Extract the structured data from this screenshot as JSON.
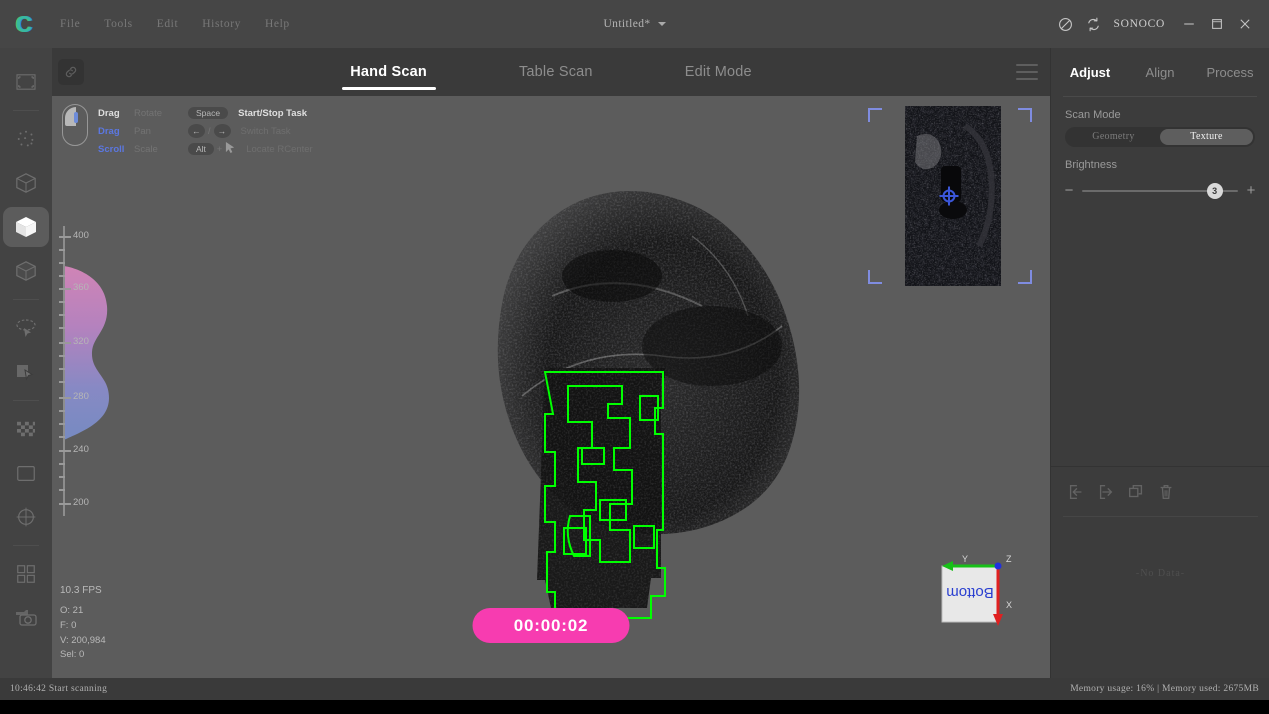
{
  "titlebar": {
    "logo": "crescent-logo",
    "menu": [
      "File",
      "Tools",
      "Edit",
      "History",
      "Help"
    ],
    "document_title": "Untitled*",
    "brand": "SONOCO",
    "icons": [
      "no-entry-icon",
      "sync-icon"
    ],
    "window_buttons": [
      "minimize",
      "maximize",
      "close"
    ]
  },
  "left_toolbar": {
    "items": [
      {
        "name": "crop-frame-icon",
        "selected": false
      },
      {
        "name": "point-cloud-icon",
        "selected": false
      },
      {
        "name": "wireframe-cube-icon",
        "selected": false
      },
      {
        "name": "solid-cube-icon",
        "selected": true
      },
      {
        "name": "shaded-cube-icon",
        "selected": false
      },
      {
        "name": "lasso-select-icon",
        "selected": false
      },
      {
        "name": "plane-select-icon",
        "selected": false
      },
      {
        "name": "checkerboard-icon",
        "selected": false
      },
      {
        "name": "square-icon",
        "selected": false
      },
      {
        "name": "target-circle-icon",
        "selected": false
      },
      {
        "name": "grid-four-icon",
        "selected": false
      },
      {
        "name": "texture-camera-icon",
        "selected": false
      }
    ]
  },
  "tabbar": {
    "chain_icon": "link-icon",
    "tabs": [
      {
        "label": "Hand Scan",
        "active": true
      },
      {
        "label": "Table Scan",
        "active": false
      },
      {
        "label": "Edit Mode",
        "active": false
      }
    ],
    "menu_icon": "hamburger-icon"
  },
  "viewport": {
    "mouse_help": {
      "rows": [
        {
          "action": "Drag",
          "function": "Rotate",
          "key": "Space",
          "shortcut": "Start/Stop Task",
          "bold": true
        },
        {
          "action": "Drag",
          "function": "Pan",
          "key": "arrows",
          "shortcut": "Switch Task",
          "bold": false
        },
        {
          "action": "Scroll",
          "function": "Scale",
          "key": "Alt",
          "shortcut": "Locate RCenter",
          "bold": false
        }
      ]
    },
    "histogram": {
      "labels": [
        "400",
        "360",
        "320",
        "280",
        "240",
        "200"
      ],
      "gradient_top": "#e08ac0",
      "gradient_bottom": "#7b8fd0"
    },
    "stats": {
      "fps": "10.3 FPS",
      "lines": [
        "O: 21",
        "F: 0",
        "V: 200,984",
        "Sel: 0"
      ]
    },
    "timer": {
      "label": "00:00:02",
      "color": "#f73cb0"
    },
    "overlay_color": "#00ff00",
    "camera_preview": {
      "marker": "crosshair-target-icon",
      "bracket_color": "#7f8ce0"
    },
    "gizmo": {
      "face_label": "Bottom",
      "axes": [
        {
          "name": "X",
          "color": "#e02020"
        },
        {
          "name": "Y",
          "color": "#18c018"
        },
        {
          "name": "Z",
          "color": "#2030e0"
        }
      ]
    }
  },
  "right_panel": {
    "tabs": [
      {
        "label": "Adjust",
        "active": true
      },
      {
        "label": "Align",
        "active": false
      },
      {
        "label": "Process",
        "active": false
      }
    ],
    "scan_mode": {
      "label": "Scan Mode",
      "options": [
        "Geometry",
        "Texture"
      ],
      "selected": "Texture"
    },
    "brightness": {
      "label": "Brightness",
      "value": "3",
      "minus": "−",
      "plus": "+"
    },
    "list_tools": [
      "import-icon",
      "export-icon",
      "duplicate-icon",
      "delete-icon"
    ],
    "empty_text": "-No Data-"
  },
  "statusbar": {
    "left": "10:46:42 Start scanning",
    "right": "Memory usage: 16% | Memory used: 2675MB"
  }
}
